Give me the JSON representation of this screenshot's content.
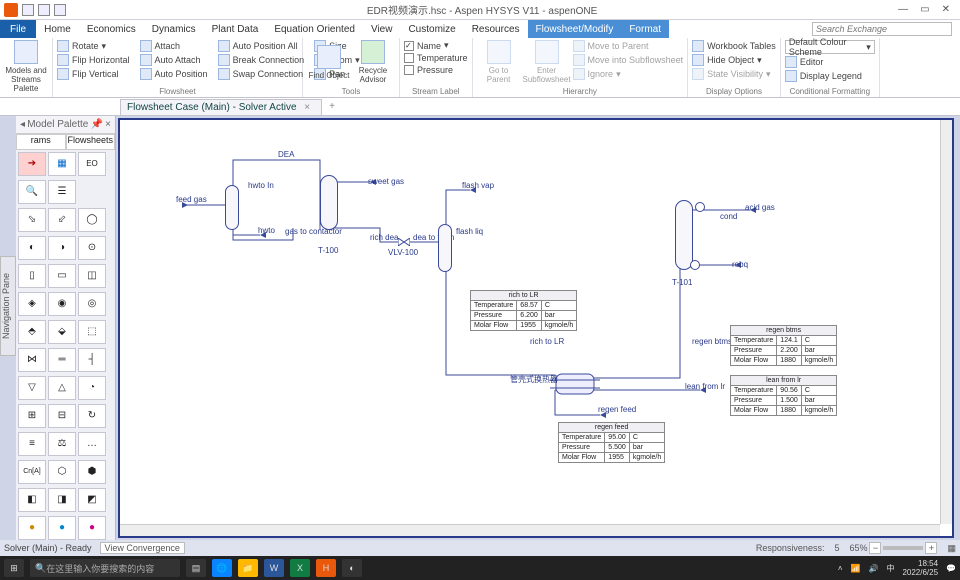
{
  "titlebar": {
    "filename": "EDR视频演示.hsc - Aspen HYSYS V11 - aspenONE"
  },
  "menubar": {
    "file": "File",
    "items": [
      "Home",
      "Economics",
      "Dynamics",
      "Plant Data",
      "Equation Oriented",
      "View",
      "Customize",
      "Resources"
    ],
    "active": "Flowsheet/Modify",
    "extra": "Format"
  },
  "search": {
    "placeholder": "Search Exchange"
  },
  "ribbon": {
    "g1": {
      "big": "Models and Streams Palette",
      "label": ""
    },
    "g2": {
      "rows": [
        "Rotate",
        "Attach",
        "Auto Position All",
        "Size",
        "Flip Horizontal",
        "Auto Attach",
        "Break Connection",
        "Zoom",
        "Flip Vertical",
        "Auto Position",
        "Swap Connection",
        "Pan"
      ],
      "label": "Flowsheet"
    },
    "g3": {
      "big1": "Find Object",
      "big2": "Recycle Advisor",
      "label": "Tools"
    },
    "g4": {
      "checks": [
        "Name",
        "Temperature",
        "Pressure"
      ],
      "label": "Stream Label"
    },
    "g5": {
      "rows": [
        "Move to Parent",
        "Move into Subflowsheet",
        "Ignore"
      ],
      "big1": "Go to Parent",
      "big2": "Enter Subflowsheet",
      "label": "Hierarchy"
    },
    "g6": {
      "rows": [
        "Workbook Tables",
        "Hide Object",
        "State Visibility"
      ],
      "label": "Display Options"
    },
    "g7": {
      "dd": "Default Colour Scheme",
      "rows": [
        "Editor",
        "Display Legend"
      ],
      "label": "Conditional Formatting"
    }
  },
  "subtab": {
    "text": "Flowsheet Case (Main) - Solver Active"
  },
  "palette": {
    "head": "Model Palette",
    "tabs": [
      "rams",
      "Flowsheets"
    ],
    "eo": "EO",
    "cna": "Cn[A]"
  },
  "navpane": "Navigation Pane",
  "flowsheet": {
    "labels": {
      "dea": "DEA",
      "feed_gas": "feed gas",
      "hwto": "hwto",
      "hwto_in": "hwto In",
      "gas_to_contactor": "gas to contactor",
      "t100": "T-100",
      "sweet_gas": "sweet gas",
      "rich_dea": "rich dea",
      "vlv": "VLV-100",
      "dea_to_flash": "dea to flash",
      "flash_vap": "flash vap",
      "flash_liq": "flash liq",
      "rich_to_lr": "rich to LR",
      "hx_label": "管壳式换热器",
      "regen_feed": "regen feed",
      "regen_btms": "regen btms",
      "lean_from_lr": "lean from lr",
      "t101": "T-101",
      "cond": "cond",
      "acid_gas": "acid gas",
      "rebq": "rebq"
    },
    "tables": {
      "rich_to_lr": {
        "title": "rich to LR",
        "rows": [
          [
            "Temperature",
            "68.57",
            "C"
          ],
          [
            "Pressure",
            "6.200",
            "bar"
          ],
          [
            "Molar Flow",
            "1955",
            "kgmole/h"
          ]
        ]
      },
      "regen_feed": {
        "title": "regen feed",
        "rows": [
          [
            "Temperature",
            "95.00",
            "C"
          ],
          [
            "Pressure",
            "5.500",
            "bar"
          ],
          [
            "Molar Flow",
            "1955",
            "kgmole/h"
          ]
        ]
      },
      "regen_btms": {
        "title": "regen btms",
        "rows": [
          [
            "Temperature",
            "124.1",
            "C"
          ],
          [
            "Pressure",
            "2.200",
            "bar"
          ],
          [
            "Molar Flow",
            "1880",
            "kgmole/h"
          ]
        ]
      },
      "lean_from": {
        "title": "lean from lr",
        "rows": [
          [
            "Temperature",
            "90.56",
            "C"
          ],
          [
            "Pressure",
            "1.500",
            "bar"
          ],
          [
            "Molar Flow",
            "1880",
            "kgmole/h"
          ]
        ]
      }
    }
  },
  "statusbar": {
    "left": "Solver (Main) - Ready",
    "btn": "View Convergence",
    "resp_label": "Responsiveness:",
    "resp_val": "5",
    "zoom": "65%"
  },
  "taskbar": {
    "search": "在这里输入你要搜索的内容",
    "time": "18:54",
    "date": "2022/6/25"
  }
}
